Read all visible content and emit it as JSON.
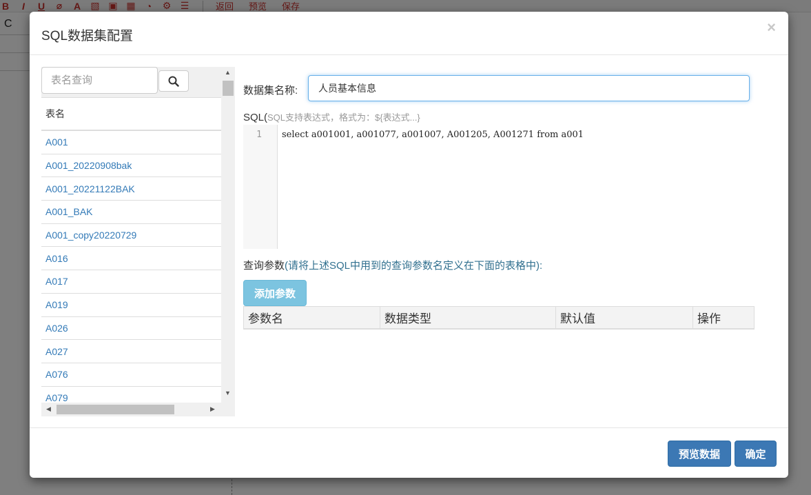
{
  "background": {
    "cell_text": "C",
    "toolbar_links": [
      "返回",
      "预览",
      "保存"
    ]
  },
  "dialog": {
    "title": "SQL数据集配置",
    "close_label": "×"
  },
  "table_list": {
    "search_placeholder": "表名查询",
    "header": "表名",
    "rows": [
      "A001",
      "A001_20220908bak",
      "A001_20221122BAK",
      "A001_BAK",
      "A001_copy20220729",
      "A016",
      "A017",
      "A019",
      "A026",
      "A027",
      "A076",
      "A079"
    ]
  },
  "form": {
    "name_label": "数据集名称:",
    "name_value": "人员基本信息",
    "sql_label": "SQL(",
    "sql_hint": "SQL支持表达式，格式为：${表达式...}",
    "sql_line_number": "1",
    "sql_code": "select a001001, a001077, a001007, A001205, A001271 from a001",
    "params_label": "查询参数",
    "params_hint": "(请将上述SQL中用到的查询参数名定义在下面的表格中):",
    "add_param_label": "添加参数",
    "params_columns": [
      "参数名",
      "数据类型",
      "默认值",
      "操作"
    ]
  },
  "footer": {
    "preview_label": "预览数据",
    "confirm_label": "确定"
  }
}
